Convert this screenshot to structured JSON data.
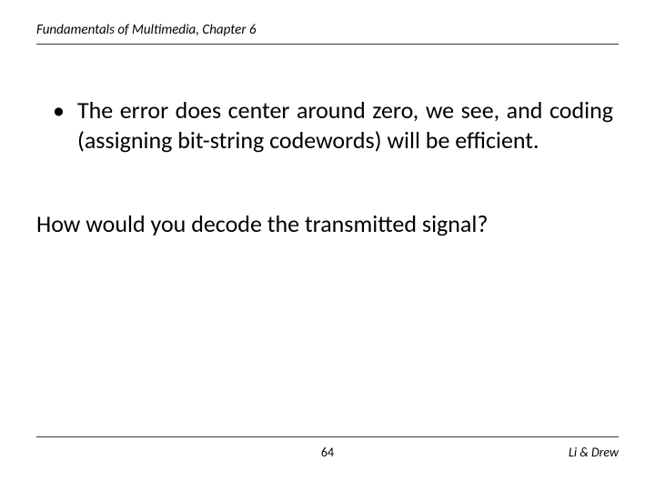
{
  "header": {
    "title_prefix": "Fundamentals of Multimedia",
    "chapter": ", Chapter 6"
  },
  "content": {
    "bullet_marker": "•",
    "bullet_text": "The error does center around zero, we see, and coding (assigning bit-string codewords) will be efficient.",
    "question": "How would you decode the transmitted signal?"
  },
  "footer": {
    "page_number": "64",
    "authors": "Li & Drew"
  }
}
